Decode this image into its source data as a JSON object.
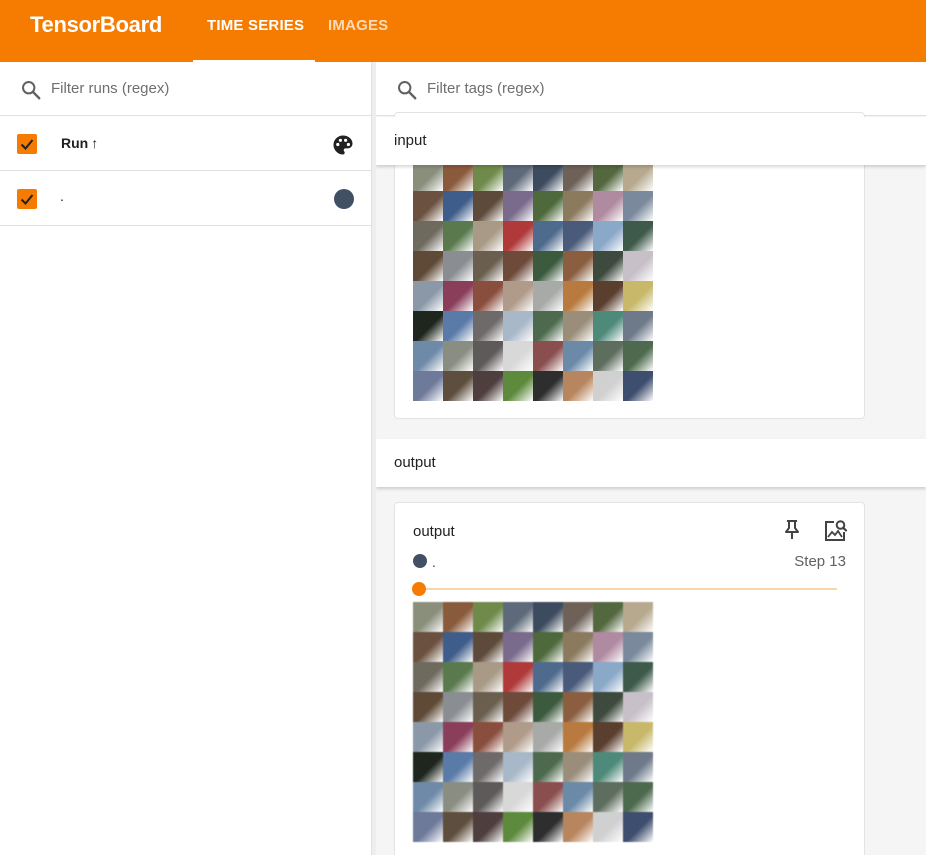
{
  "app": {
    "brand": "TensorBoard",
    "tabs": [
      {
        "label": "TIME SERIES",
        "active": true
      },
      {
        "label": "IMAGES",
        "active": false
      }
    ],
    "accent_color": "#f57c00"
  },
  "sidebar": {
    "filter_placeholder": "Filter runs (regex)",
    "header": {
      "label": "Run",
      "sort_indicator": "↑",
      "checked": true
    },
    "runs": [
      {
        "name": ".",
        "checked": true,
        "color": "#425066"
      }
    ]
  },
  "main": {
    "filter_placeholder": "Filter tags (regex)",
    "groups": [
      {
        "name": "input"
      },
      {
        "name": "output",
        "card": {
          "title": "output",
          "run_name": ".",
          "run_color": "#425066",
          "step_label": "Step 13",
          "slider_position": 0.0
        }
      }
    ]
  },
  "image_grid": {
    "rows": 8,
    "cols": 8,
    "tile_colors": [
      "#8a8f7c",
      "#8a5a3c",
      "#6f8a4a",
      "#5e6a7a",
      "#3d4b5e",
      "#6e6258",
      "#54683f",
      "#b6a98e",
      "#6b5240",
      "#3f5d8a",
      "#5e4a3a",
      "#7a6a8c",
      "#4e6a3c",
      "#8c7a5e",
      "#b08aa0",
      "#7a8a9c",
      "#6e6a5e",
      "#5a7a4e",
      "#a89a86",
      "#b03a3a",
      "#4e6a8c",
      "#4a5a7a",
      "#8aa8c8",
      "#3e5a4a",
      "#5e4a36",
      "#8a8e92",
      "#6a5e4e",
      "#6e4a3a",
      "#3c5a3e",
      "#8a5e3e",
      "#3e4a3e",
      "#c8c0c8",
      "#8a98a8",
      "#8a3e5a",
      "#8a4e3e",
      "#b09a8a",
      "#a8aaa8",
      "#b87a3e",
      "#5a3e2e",
      "#c8b86a",
      "#1e261e",
      "#5a7aa8",
      "#6e6a6a",
      "#a8b8c8",
      "#4e6a4e",
      "#9a8e7a",
      "#4e8a7a",
      "#6e7a8a",
      "#6e8aa8",
      "#8a8e82",
      "#5e5a5a",
      "#d8d8d8",
      "#8a4e4e",
      "#6a8aa8",
      "#5e6e5e",
      "#4e6a4e",
      "#6e7a9a",
      "#5e4e3e",
      "#4e3e3e",
      "#5e8a3e",
      "#2e2e2e",
      "#b8865e",
      "#d0d0d0",
      "#3e4e6e"
    ]
  }
}
